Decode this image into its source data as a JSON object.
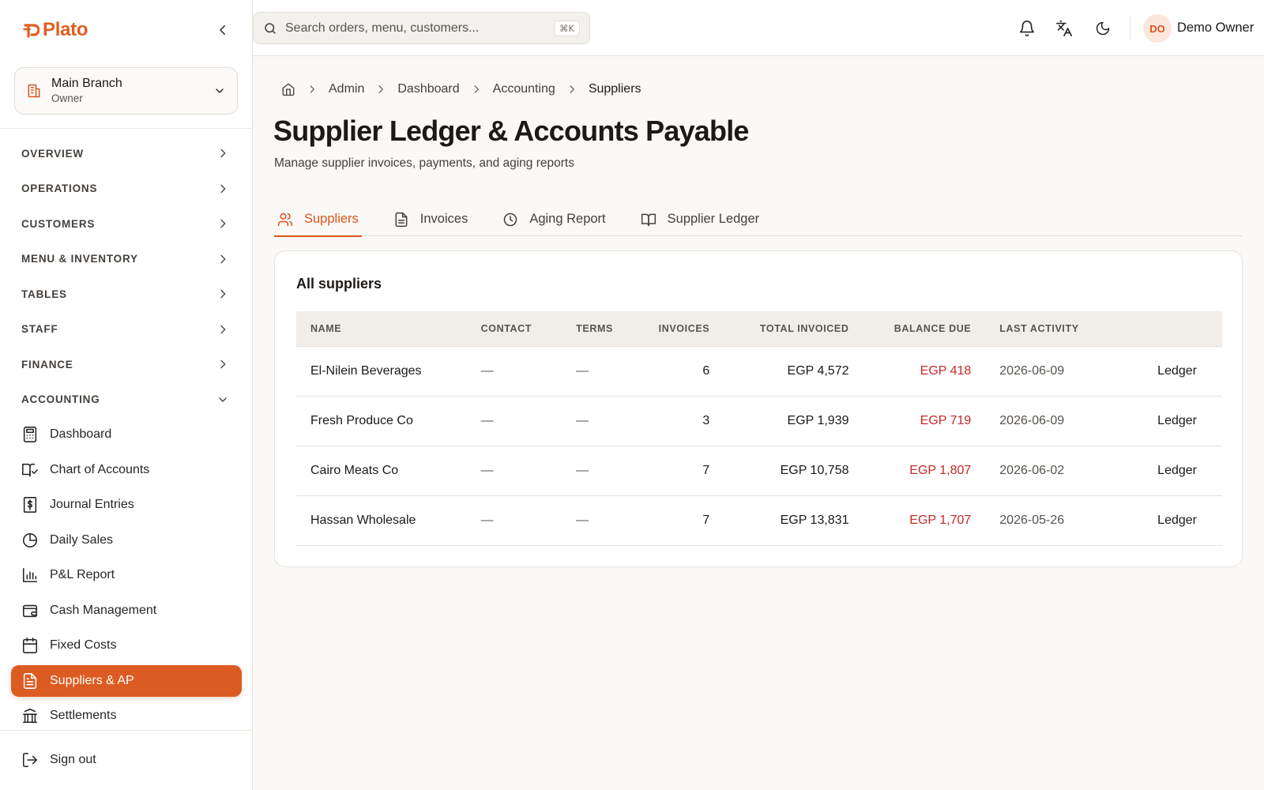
{
  "brand": {
    "name": "Plato",
    "accent": "#dc5b22"
  },
  "branch": {
    "name": "Main Branch",
    "role": "Owner"
  },
  "sidebar": {
    "sections": [
      {
        "label": "OVERVIEW"
      },
      {
        "label": "OPERATIONS"
      },
      {
        "label": "CUSTOMERS"
      },
      {
        "label": "MENU & INVENTORY"
      },
      {
        "label": "TABLES"
      },
      {
        "label": "STAFF"
      },
      {
        "label": "FINANCE"
      },
      {
        "label": "ACCOUNTING",
        "expanded": true
      }
    ],
    "accounting_items": [
      {
        "label": "Dashboard",
        "icon": "calculator-icon"
      },
      {
        "label": "Chart of Accounts",
        "icon": "book-check-icon"
      },
      {
        "label": "Journal Entries",
        "icon": "receipt-dollar-icon"
      },
      {
        "label": "Daily Sales",
        "icon": "pie-chart-icon"
      },
      {
        "label": "P&L Report",
        "icon": "bar-chart-icon"
      },
      {
        "label": "Cash Management",
        "icon": "wallet-icon"
      },
      {
        "label": "Fixed Costs",
        "icon": "calendar-icon"
      },
      {
        "label": "Suppliers & AP",
        "icon": "file-text-icon",
        "active": true
      },
      {
        "label": "Settlements",
        "icon": "bank-icon"
      }
    ],
    "signout": "Sign out"
  },
  "topbar": {
    "search_placeholder": "Search orders, menu, customers...",
    "search_shortcut": "⌘K",
    "user_initials": "DO",
    "user_name": "Demo Owner"
  },
  "breadcrumb": [
    "Admin",
    "Dashboard",
    "Accounting",
    "Suppliers"
  ],
  "page": {
    "title": "Supplier Ledger & Accounts Payable",
    "subtitle": "Manage supplier invoices, payments, and aging reports"
  },
  "tabs": [
    {
      "label": "Suppliers",
      "icon": "users-icon",
      "active": true
    },
    {
      "label": "Invoices",
      "icon": "file-icon"
    },
    {
      "label": "Aging Report",
      "icon": "clock-icon"
    },
    {
      "label": "Supplier Ledger",
      "icon": "open-book-icon"
    }
  ],
  "suppliers_card": {
    "title": "All suppliers",
    "columns": [
      "NAME",
      "CONTACT",
      "TERMS",
      "INVOICES",
      "TOTAL INVOICED",
      "BALANCE DUE",
      "LAST ACTIVITY",
      ""
    ],
    "rows": [
      {
        "name": "El-Nilein Beverages",
        "contact": "—",
        "terms": "—",
        "invoices": "6",
        "total": "EGP 4,572",
        "due": "EGP 418",
        "last": "2026-06-09",
        "action": "Ledger"
      },
      {
        "name": "Fresh Produce Co",
        "contact": "—",
        "terms": "—",
        "invoices": "3",
        "total": "EGP 1,939",
        "due": "EGP 719",
        "last": "2026-06-09",
        "action": "Ledger"
      },
      {
        "name": "Cairo Meats Co",
        "contact": "—",
        "terms": "—",
        "invoices": "7",
        "total": "EGP 10,758",
        "due": "EGP 1,807",
        "last": "2026-06-02",
        "action": "Ledger"
      },
      {
        "name": "Hassan Wholesale",
        "contact": "—",
        "terms": "—",
        "invoices": "7",
        "total": "EGP 13,831",
        "due": "EGP 1,707",
        "last": "2026-05-26",
        "action": "Ledger"
      }
    ]
  },
  "colors": {
    "accent": "#dc5b22",
    "due": "#c62828",
    "background": "#faf9f7"
  }
}
